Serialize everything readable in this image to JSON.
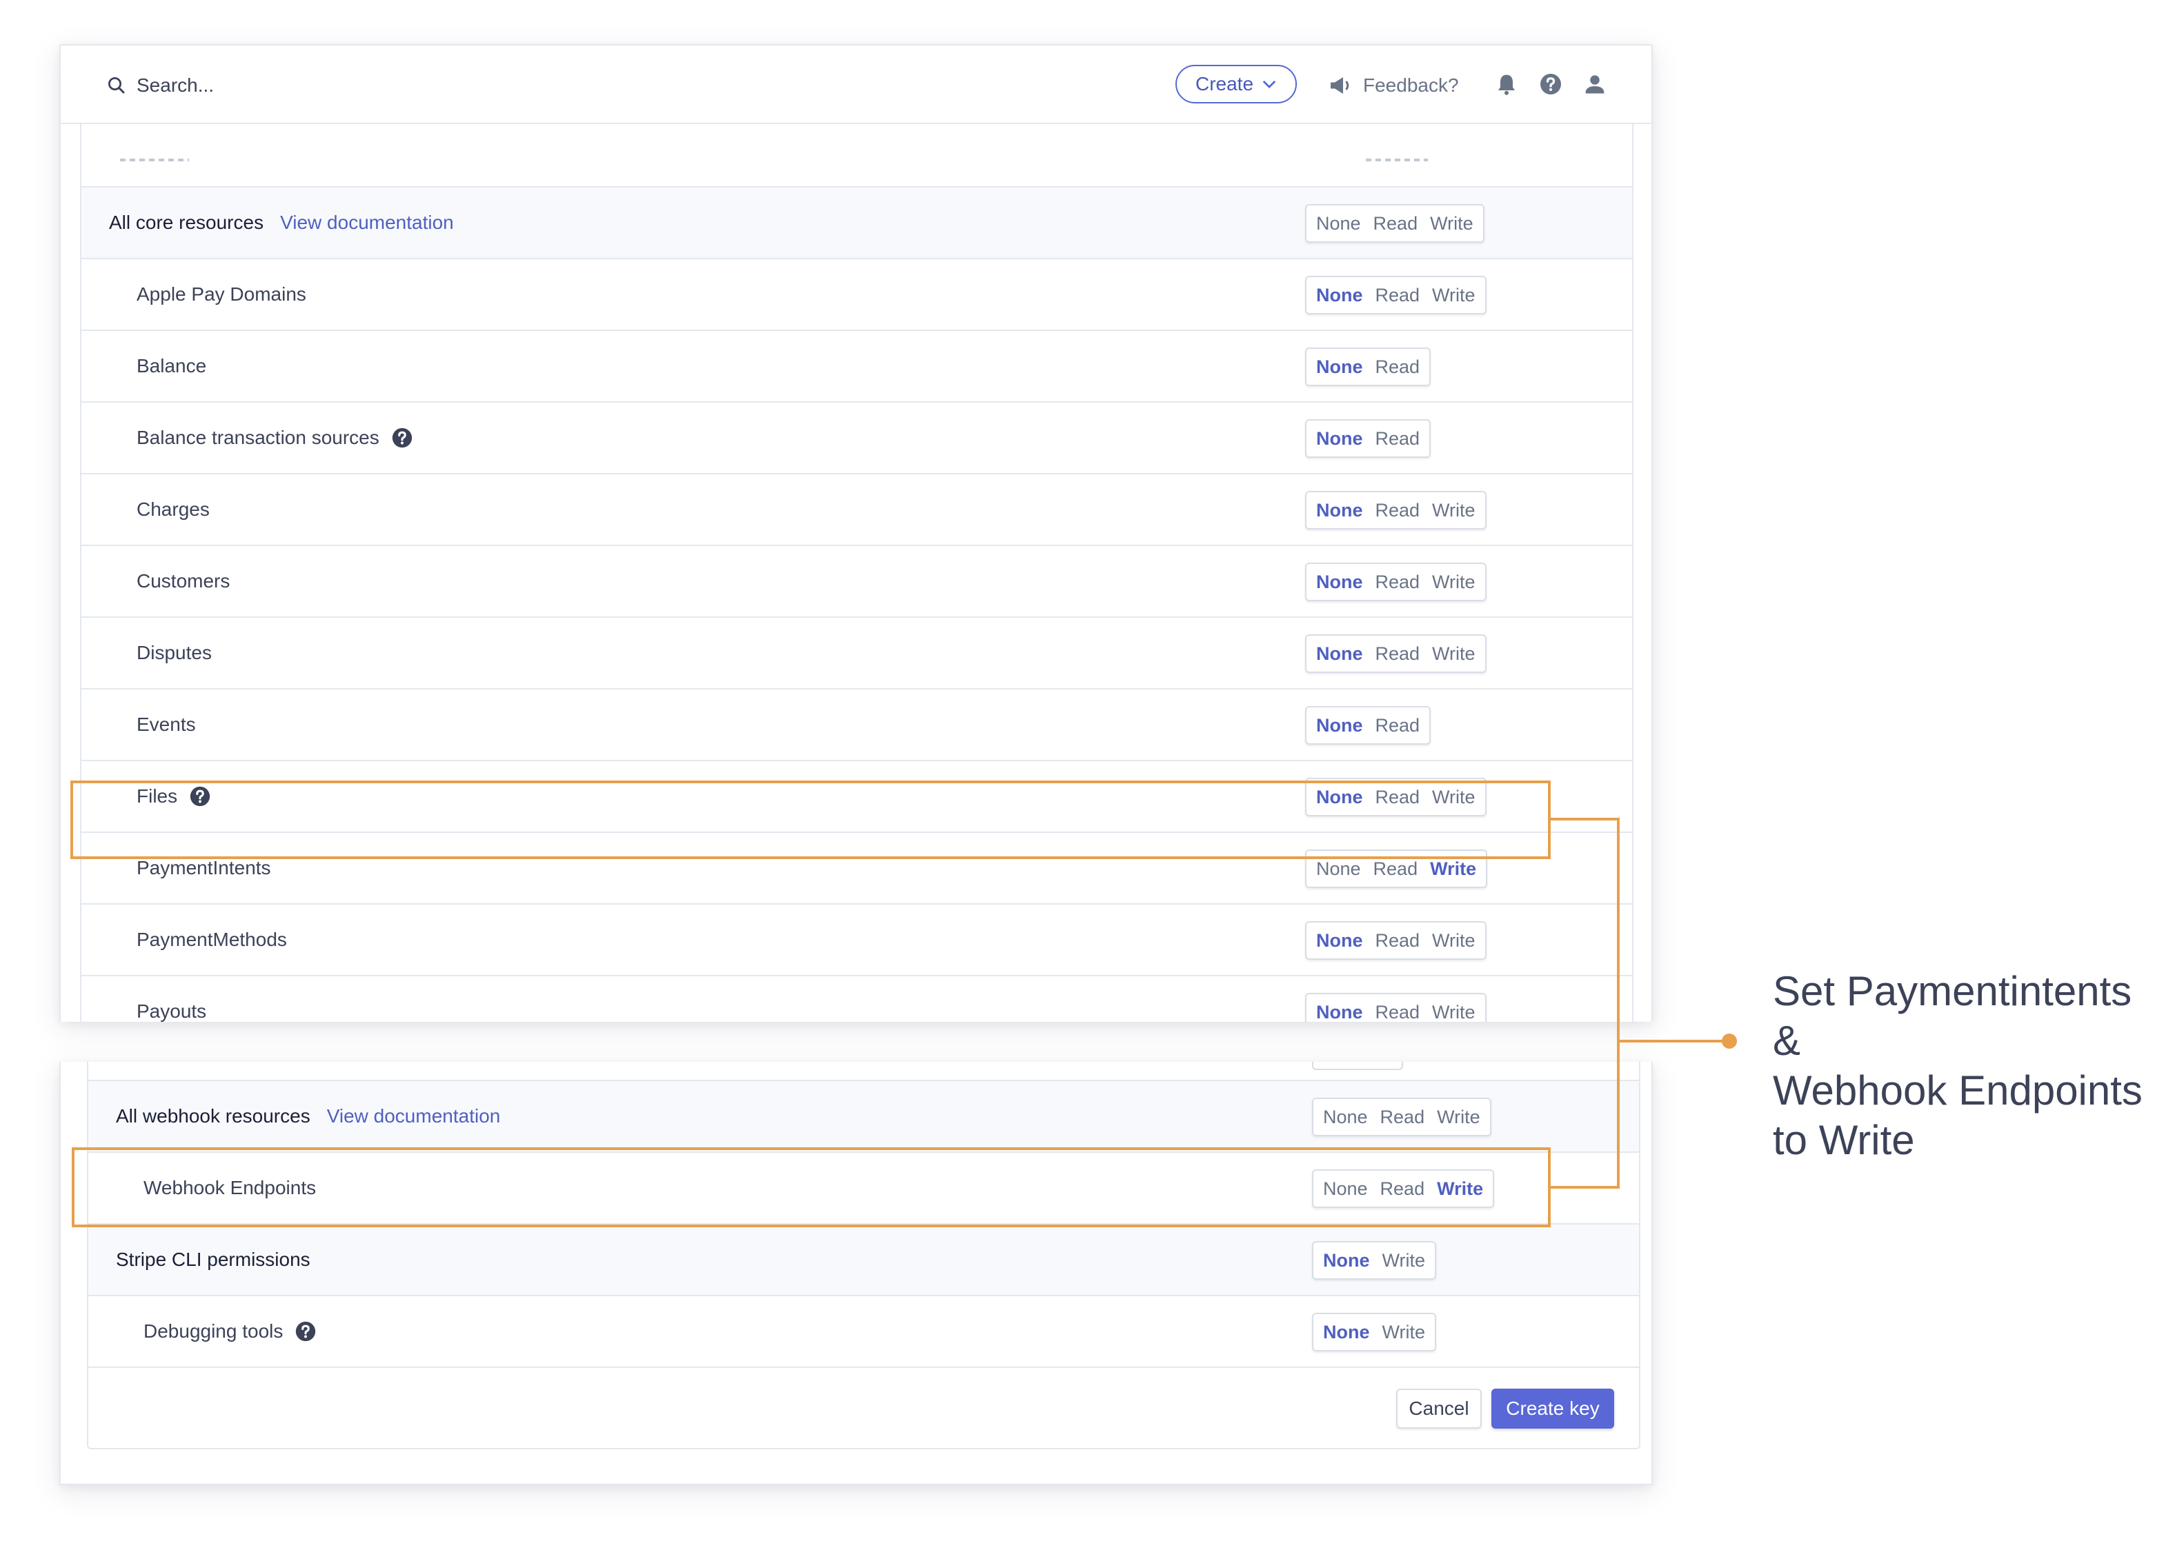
{
  "topbar": {
    "search_placeholder": "Search...",
    "create_label": "Create",
    "feedback_label": "Feedback?"
  },
  "top_rows": [
    {
      "label": "All core resources",
      "link": "View documentation",
      "section": true,
      "options": [
        "None",
        "Read",
        "Write"
      ],
      "selected": null
    },
    {
      "label": "Apple Pay Domains",
      "options": [
        "None",
        "Read",
        "Write"
      ],
      "selected": "None"
    },
    {
      "label": "Balance",
      "options": [
        "None",
        "Read"
      ],
      "selected": "None"
    },
    {
      "label": "Balance transaction sources",
      "help": true,
      "options": [
        "None",
        "Read"
      ],
      "selected": "None"
    },
    {
      "label": "Charges",
      "options": [
        "None",
        "Read",
        "Write"
      ],
      "selected": "None"
    },
    {
      "label": "Customers",
      "options": [
        "None",
        "Read",
        "Write"
      ],
      "selected": "None"
    },
    {
      "label": "Disputes",
      "options": [
        "None",
        "Read",
        "Write"
      ],
      "selected": "None"
    },
    {
      "label": "Events",
      "options": [
        "None",
        "Read"
      ],
      "selected": "None"
    },
    {
      "label": "Files",
      "help": true,
      "options": [
        "None",
        "Read",
        "Write"
      ],
      "selected": "None"
    },
    {
      "label": "PaymentIntents",
      "options": [
        "None",
        "Read",
        "Write"
      ],
      "selected": "Write"
    },
    {
      "label": "PaymentMethods",
      "options": [
        "None",
        "Read",
        "Write"
      ],
      "selected": "None"
    },
    {
      "label": "Payouts",
      "options": [
        "None",
        "Read",
        "Write"
      ],
      "selected": "None"
    }
  ],
  "bottom_rows": [
    {
      "label": "All webhook resources",
      "link": "View documentation",
      "section": true,
      "options": [
        "None",
        "Read",
        "Write"
      ],
      "selected": null
    },
    {
      "label": "Webhook Endpoints",
      "options": [
        "None",
        "Read",
        "Write"
      ],
      "selected": "Write"
    },
    {
      "label": "Stripe CLI permissions",
      "section": true,
      "options": [
        "None",
        "Write"
      ],
      "selected": "None"
    },
    {
      "label": "Debugging tools",
      "help": true,
      "options": [
        "None",
        "Write"
      ],
      "selected": "None"
    }
  ],
  "footer": {
    "cancel_label": "Cancel",
    "create_key_label": "Create key"
  },
  "annotation": {
    "line1": "Set Paymentintents &",
    "line2": "Webhook Endpoints",
    "line3": "to Write",
    "color": "#e7a04c"
  },
  "colors": {
    "accent": "#5469d4",
    "selected_text": "#4f5fc0",
    "section_bg": "#f7f9fc",
    "border": "#e3e8ee"
  }
}
